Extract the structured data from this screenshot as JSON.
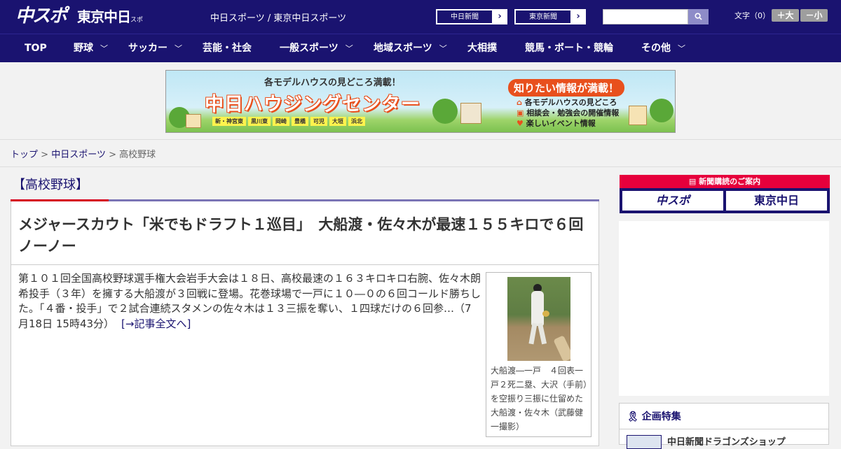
{
  "header": {
    "logo_chuspo": "中スポ",
    "logo_tokyo": "東京中日",
    "logo_tokyo_small": "スポーツ",
    "site_name": "中日スポーツ / 東京中日スポーツ",
    "link_chunichi": "中日新聞",
    "link_tokyo": "東京新聞",
    "search_placeholder": "",
    "font_size_label": "文字（0）",
    "font_larger": "＋大",
    "font_smaller": "－小"
  },
  "nav": {
    "items": [
      {
        "label": "TOP",
        "has_dropdown": false
      },
      {
        "label": "野球",
        "has_dropdown": true
      },
      {
        "label": "サッカー",
        "has_dropdown": true
      },
      {
        "label": "芸能・社会",
        "has_dropdown": false
      },
      {
        "label": "一般スポーツ",
        "has_dropdown": true
      },
      {
        "label": "地域スポーツ",
        "has_dropdown": true
      },
      {
        "label": "大相撲",
        "has_dropdown": false
      },
      {
        "label": "競馬・ボート・競輪",
        "has_dropdown": false
      },
      {
        "label": "その他",
        "has_dropdown": true
      }
    ]
  },
  "banner": {
    "top_text": "各モデルハウスの見どころ満載！",
    "title": "中日ハウジングセンター",
    "towns": [
      "新・神宮東",
      "黒川東",
      "岡崎",
      "豊橋",
      "可児",
      "大垣",
      "浜北"
    ],
    "right_head": "知りたい情報が満載！",
    "right_items": [
      "各モデルハウスの見どころ",
      "相談会・勉強会の開催情報",
      "楽しいイベント情報"
    ]
  },
  "breadcrumb": {
    "home": "トップ",
    "section": "中日スポーツ",
    "current": "高校野球",
    "sep": ">"
  },
  "article": {
    "category": "【高校野球】",
    "headline": "メジャースカウト「米でもドラフト１巡目」　大船渡・佐々木が最速１５５キロで６回ノーノー",
    "body": "第１０１回全国高校野球選手権大会岩手大会は１８日、高校最速の１６３キロキロ右腕、佐々木朗希投手（３年）を擁する大船渡が３回戦に登場。花巻球場で一戸に１０―０の６回コールド勝ちした。「４番・投手」で２試合連続スタメンの佐々木は１３三振を奪い、１四球だけの６回参…（7月18日 15時43分）",
    "more_link": "[→記事全文へ]",
    "photo_caption": "大船渡―一戸　４回表一戸２死二塁、大沢（手前）を空振り三振に仕留めた大船渡・佐々木（武藤健一撮影）"
  },
  "sidebar": {
    "subscribe_head": "新聞購読のご案内",
    "subscribe_chuspo": "中スポ",
    "subscribe_tokyo": "東京中日",
    "feature_head": "企画特集",
    "feature_item": "中日新聞ドラゴンズショップ"
  },
  "colors": {
    "brand_navy": "#1a1370",
    "accent_red": "#d6001c",
    "accent_purple": "#7a74b5"
  }
}
